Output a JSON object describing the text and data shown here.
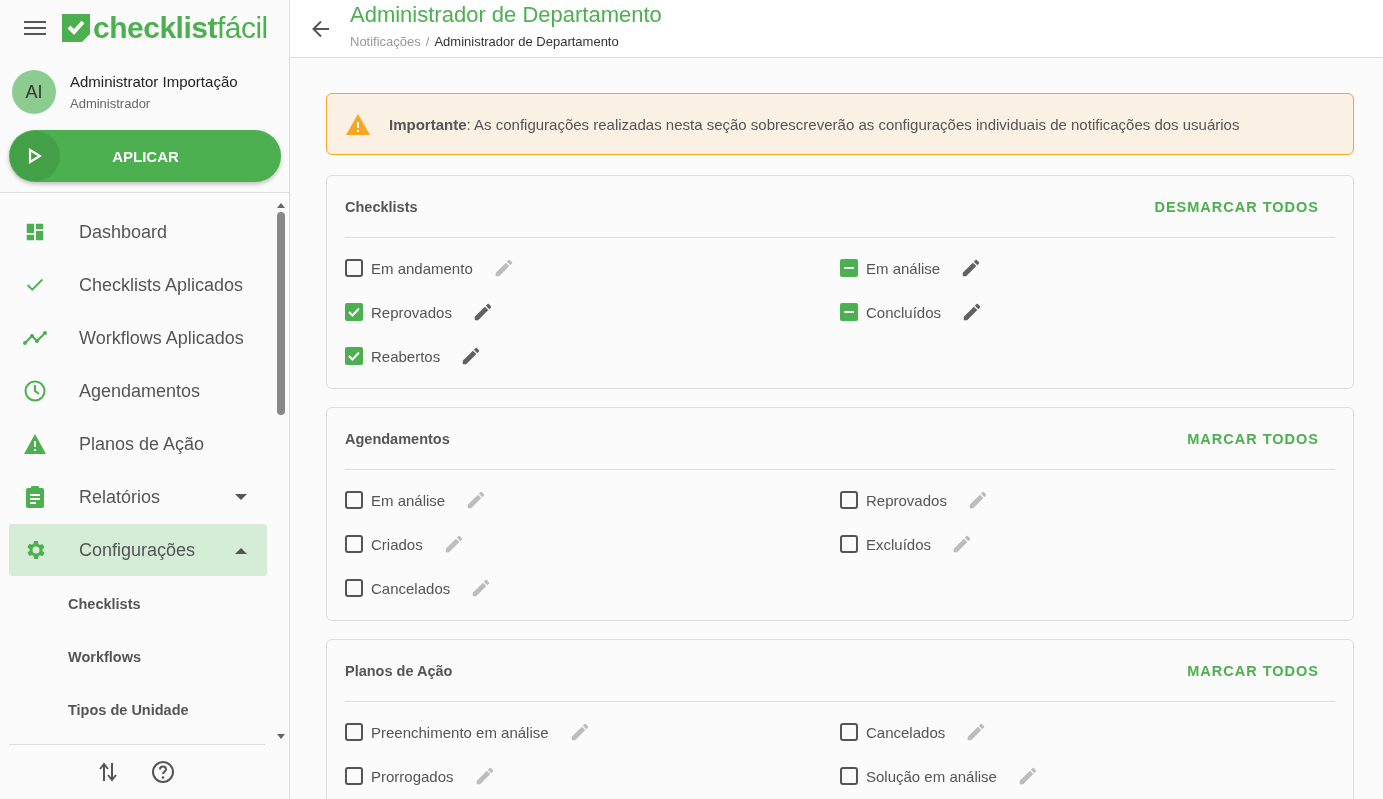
{
  "sidebar": {
    "logo": {
      "word_bold": "checklist",
      "word_light": "fácil"
    },
    "user": {
      "initials": "AI",
      "name": "Administrator Importação",
      "role": "Administrador"
    },
    "apply_button": "APLICAR",
    "items": [
      {
        "label": "Dashboard",
        "selected": false
      },
      {
        "label": "Checklists Aplicados",
        "selected": false
      },
      {
        "label": "Workflows Aplicados",
        "selected": false
      },
      {
        "label": "Agendamentos",
        "selected": false
      },
      {
        "label": "Planos de Ação",
        "selected": false
      },
      {
        "label": "Relatórios",
        "selected": false,
        "expanded": false
      },
      {
        "label": "Configurações",
        "selected": true,
        "expanded": true,
        "children": [
          {
            "label": "Checklists"
          },
          {
            "label": "Workflows"
          },
          {
            "label": "Tipos de Unidade"
          }
        ]
      }
    ]
  },
  "header": {
    "title": "Administrador de Departamento",
    "breadcrumb": {
      "parent": "Notificações",
      "separator": "/",
      "current": "Administrador de Departamento"
    }
  },
  "alert": {
    "label": "Importante",
    "text": ": As configurações realizadas nesta seção sobrescreverão as configurações individuais de notificações dos usuários"
  },
  "sections": [
    {
      "title": "Checklists",
      "action": "DESMARCAR TODOS",
      "items": [
        {
          "label": "Em andamento",
          "checked": false,
          "indeterminate": false
        },
        {
          "label": "Em análise",
          "indeterminate": true
        },
        {
          "label": "Reprovados",
          "checked": true,
          "indeterminate": false
        },
        {
          "label": "Concluídos",
          "indeterminate": true
        },
        {
          "label": "Reabertos",
          "checked": true,
          "indeterminate": false
        }
      ]
    },
    {
      "title": "Agendamentos",
      "action": "MARCAR TODOS",
      "items": [
        {
          "label": "Em análise",
          "checked": false,
          "indeterminate": false
        },
        {
          "label": "Reprovados",
          "checked": false,
          "indeterminate": false
        },
        {
          "label": "Criados",
          "checked": false,
          "indeterminate": false
        },
        {
          "label": "Excluídos",
          "checked": false,
          "indeterminate": false
        },
        {
          "label": "Cancelados",
          "checked": false,
          "indeterminate": false
        }
      ]
    },
    {
      "title": "Planos de Ação",
      "action": "MARCAR TODOS",
      "items": [
        {
          "label": "Preenchimento em análise",
          "checked": false,
          "indeterminate": false
        },
        {
          "label": "Cancelados",
          "checked": false,
          "indeterminate": false
        },
        {
          "label": "Prorrogados",
          "checked": false,
          "indeterminate": false
        },
        {
          "label": "Solução em análise",
          "checked": false,
          "indeterminate": false
        }
      ]
    }
  ]
}
